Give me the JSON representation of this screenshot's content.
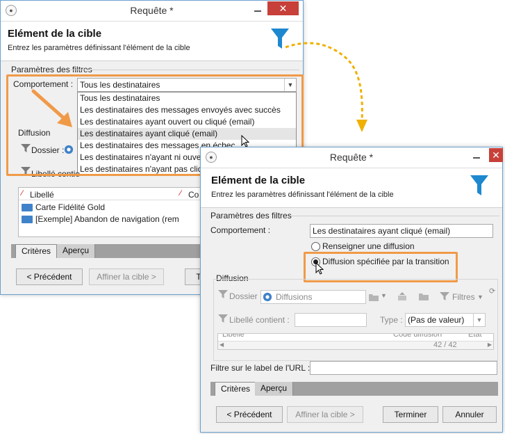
{
  "colors": {
    "accent_orange": "#f09a48",
    "funnel_blue": "#1e88cf",
    "close_red": "#c7403a"
  },
  "back_window": {
    "title": "Requête *",
    "header_title": "Elément de la cible",
    "header_subtitle": "Entrez les paramètres définissant l'élément de la cible",
    "filters_group": "Paramètres des filtres",
    "behavior_label": "Comportement :",
    "behavior_value": "Tous les destinataires",
    "dropdown_options": [
      "Tous les destinataires",
      "Les destinataires des messages envoyés avec succès",
      "Les destinataires ayant ouvert ou cliqué (email)",
      "Les destinataires ayant cliqué (email)",
      "Les destinataires des messages en échec",
      "Les destinataires n'ayant ni ouvert",
      "Les destinataires n'ayant pas cliqué"
    ],
    "diffusion_group": "Diffusion",
    "folder_label": "Dossier :",
    "label_contains": "Libellé contie",
    "col_label": "Libellé",
    "col_code": "Co",
    "rows": [
      "Carte Fidélité Gold",
      "[Exemple] Abandon de navigation (rem"
    ],
    "tabs": [
      "Critères",
      "Aperçu"
    ],
    "btn_prev": "< Précédent",
    "btn_refine": "Affiner la cible >",
    "btn_finish_cut": "T"
  },
  "front_window": {
    "title": "Requête *",
    "header_title": "Elément de la cible",
    "header_subtitle": "Entrez les paramètres définissant l'élément de la cible",
    "filters_group": "Paramètres des filtres",
    "behavior_label": "Comportement :",
    "behavior_value": "Les destinataires ayant cliqué (email)",
    "radio_1": "Renseigner une diffusion",
    "radio_2": "Diffusion spécifiée par la transition",
    "diffusion_group": "Diffusion",
    "folder_label": "Dossier :",
    "folder_value": "Diffusions",
    "filters_button": "Filtres",
    "label_contains": "Libellé contient :",
    "type_label": "Type :",
    "type_value": "(Pas de valeur)",
    "list_header_cut": "Libellé",
    "list_header_cut2": "Code diffusion",
    "list_header_cut3": "Etat",
    "count": "42 / 42",
    "url_filter_label": "Filtre sur le label de l'URL :",
    "tabs": [
      "Critères",
      "Aperçu"
    ],
    "btn_prev": "< Précédent",
    "btn_refine": "Affiner la cible >",
    "btn_finish": "Terminer",
    "btn_cancel": "Annuler"
  }
}
